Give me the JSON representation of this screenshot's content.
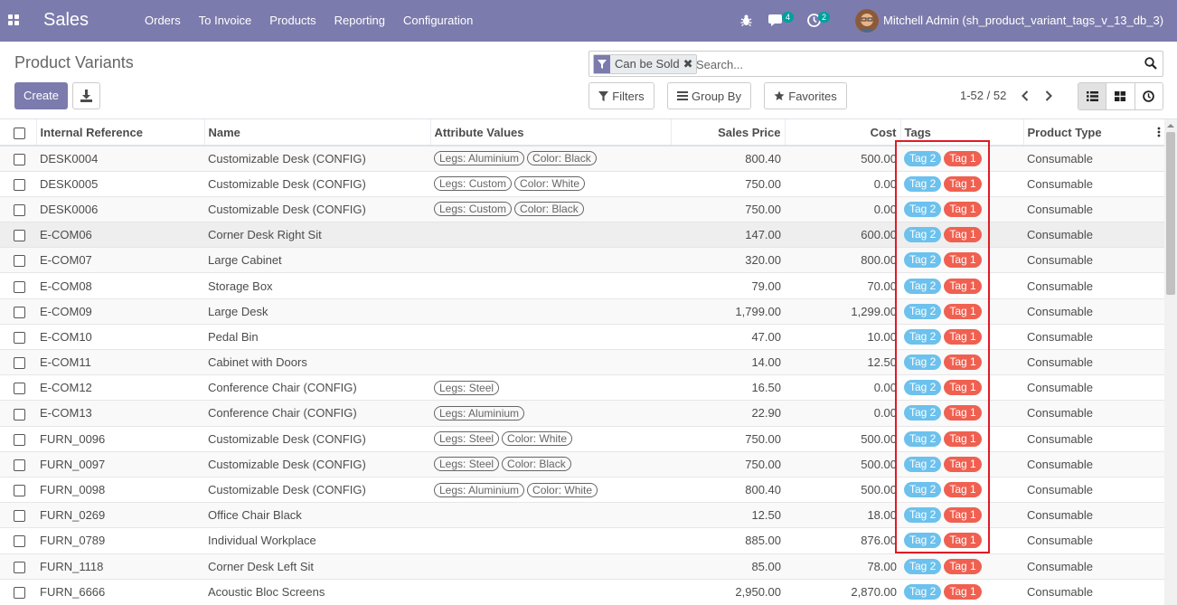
{
  "nav": {
    "brand": "Sales",
    "menu": [
      "Orders",
      "To Invoice",
      "Products",
      "Reporting",
      "Configuration"
    ],
    "chat_count": "4",
    "activity_count": "2",
    "user": "Mitchell Admin (sh_product_variant_tags_v_13_db_3)"
  },
  "control": {
    "title": "Product Variants",
    "create_label": "Create",
    "facet_value": "Can be Sold",
    "search_placeholder": "Search...",
    "filters_label": "Filters",
    "groupby_label": "Group By",
    "favorites_label": "Favorites",
    "pager": "1-52 / 52"
  },
  "columns": {
    "ref": "Internal Reference",
    "name": "Name",
    "attrs": "Attribute Values",
    "price": "Sales Price",
    "cost": "Cost",
    "tags": "Tags",
    "type": "Product Type"
  },
  "tags": {
    "tag2": "Tag 2",
    "tag1": "Tag 1"
  },
  "colors": {
    "navbar": "#7c7bad",
    "tag2": "#6cc1ed",
    "tag1": "#f06050",
    "highlight": "#e01b24"
  },
  "rows": [
    {
      "ref": "DESK0004",
      "name": "Customizable Desk (CONFIG)",
      "attrs": [
        "Legs: Aluminium",
        "Color: Black"
      ],
      "price": "800.40",
      "cost": "500.00",
      "type": "Consumable"
    },
    {
      "ref": "DESK0005",
      "name": "Customizable Desk (CONFIG)",
      "attrs": [
        "Legs: Custom",
        "Color: White"
      ],
      "price": "750.00",
      "cost": "0.00",
      "type": "Consumable"
    },
    {
      "ref": "DESK0006",
      "name": "Customizable Desk (CONFIG)",
      "attrs": [
        "Legs: Custom",
        "Color: Black"
      ],
      "price": "750.00",
      "cost": "0.00",
      "type": "Consumable"
    },
    {
      "ref": "E-COM06",
      "name": "Corner Desk Right Sit",
      "attrs": [],
      "price": "147.00",
      "cost": "600.00",
      "type": "Consumable"
    },
    {
      "ref": "E-COM07",
      "name": "Large Cabinet",
      "attrs": [],
      "price": "320.00",
      "cost": "800.00",
      "type": "Consumable"
    },
    {
      "ref": "E-COM08",
      "name": "Storage Box",
      "attrs": [],
      "price": "79.00",
      "cost": "70.00",
      "type": "Consumable"
    },
    {
      "ref": "E-COM09",
      "name": "Large Desk",
      "attrs": [],
      "price": "1,799.00",
      "cost": "1,299.00",
      "type": "Consumable"
    },
    {
      "ref": "E-COM10",
      "name": "Pedal Bin",
      "attrs": [],
      "price": "47.00",
      "cost": "10.00",
      "type": "Consumable"
    },
    {
      "ref": "E-COM11",
      "name": "Cabinet with Doors",
      "attrs": [],
      "price": "14.00",
      "cost": "12.50",
      "type": "Consumable"
    },
    {
      "ref": "E-COM12",
      "name": "Conference Chair (CONFIG)",
      "attrs": [
        "Legs: Steel"
      ],
      "price": "16.50",
      "cost": "0.00",
      "type": "Consumable"
    },
    {
      "ref": "E-COM13",
      "name": "Conference Chair (CONFIG)",
      "attrs": [
        "Legs: Aluminium"
      ],
      "price": "22.90",
      "cost": "0.00",
      "type": "Consumable"
    },
    {
      "ref": "FURN_0096",
      "name": "Customizable Desk (CONFIG)",
      "attrs": [
        "Legs: Steel",
        "Color: White"
      ],
      "price": "750.00",
      "cost": "500.00",
      "type": "Consumable"
    },
    {
      "ref": "FURN_0097",
      "name": "Customizable Desk (CONFIG)",
      "attrs": [
        "Legs: Steel",
        "Color: Black"
      ],
      "price": "750.00",
      "cost": "500.00",
      "type": "Consumable"
    },
    {
      "ref": "FURN_0098",
      "name": "Customizable Desk (CONFIG)",
      "attrs": [
        "Legs: Aluminium",
        "Color: White"
      ],
      "price": "800.40",
      "cost": "500.00",
      "type": "Consumable"
    },
    {
      "ref": "FURN_0269",
      "name": "Office Chair Black",
      "attrs": [],
      "price": "12.50",
      "cost": "18.00",
      "type": "Consumable"
    },
    {
      "ref": "FURN_0789",
      "name": "Individual Workplace",
      "attrs": [],
      "price": "885.00",
      "cost": "876.00",
      "type": "Consumable"
    },
    {
      "ref": "FURN_1118",
      "name": "Corner Desk Left Sit",
      "attrs": [],
      "price": "85.00",
      "cost": "78.00",
      "type": "Consumable"
    },
    {
      "ref": "FURN_6666",
      "name": "Acoustic Bloc Screens",
      "attrs": [],
      "price": "2,950.00",
      "cost": "2,870.00",
      "type": "Consumable"
    }
  ]
}
